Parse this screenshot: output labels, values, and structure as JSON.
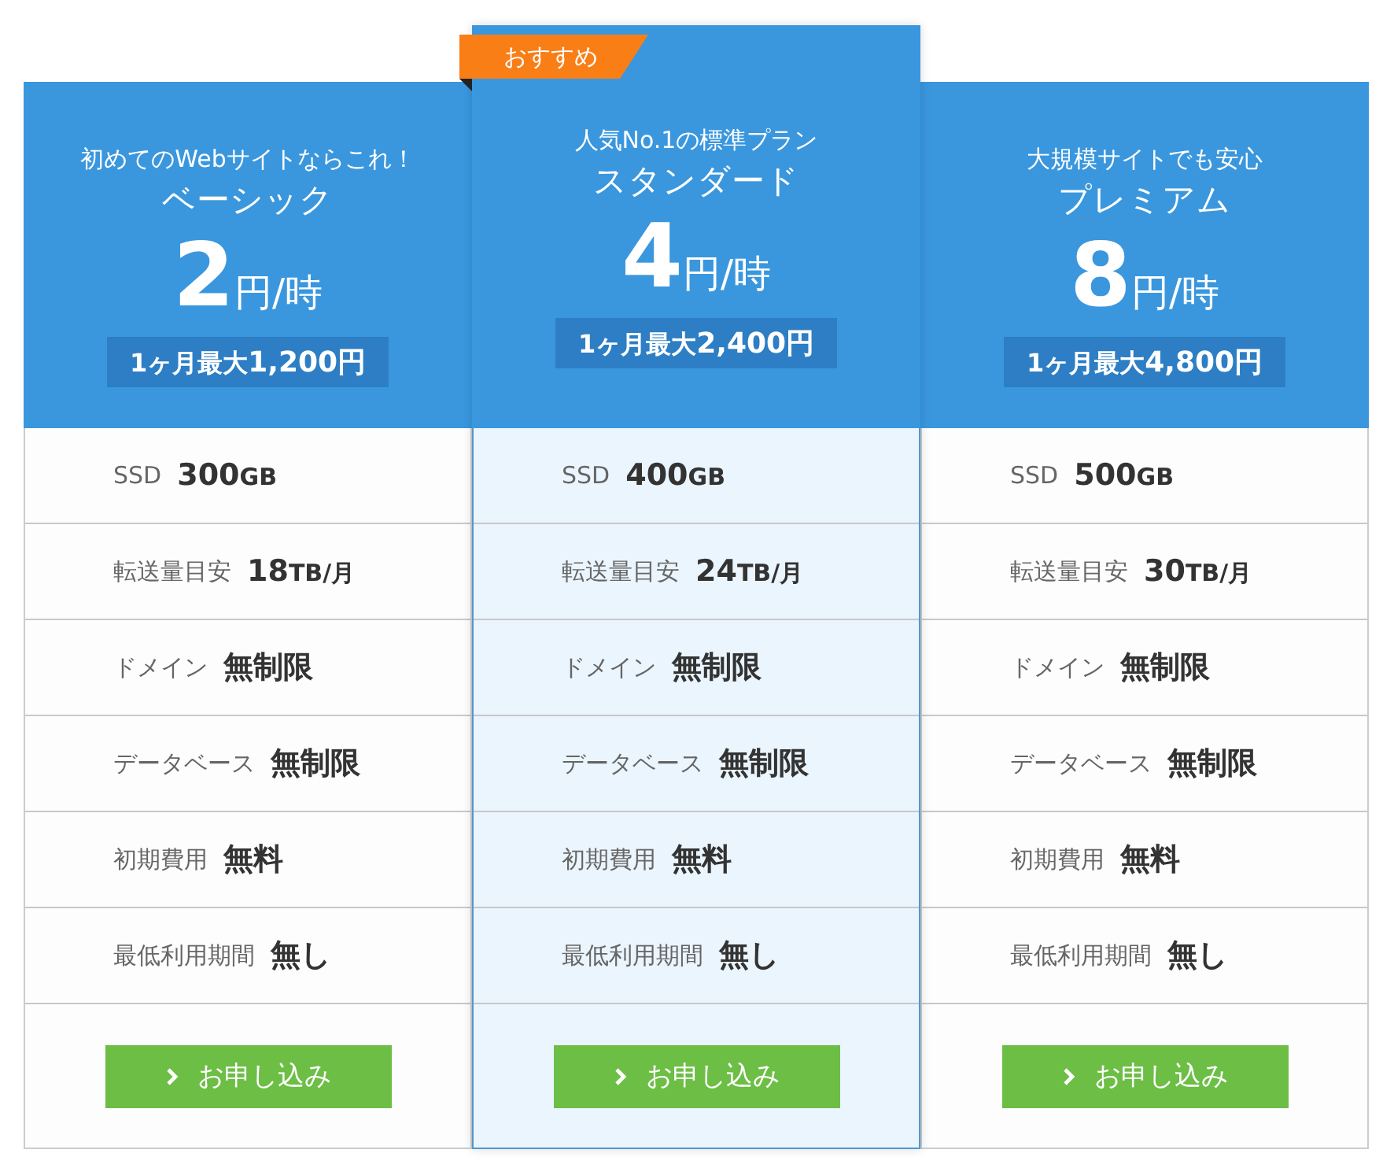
{
  "plans": [
    {
      "featured": false,
      "tagline": "初めてのWebサイトならこれ！",
      "name": "ベーシック",
      "price": "2",
      "price_unit": "円/時",
      "monthly_prefix": "1ヶ月最大",
      "monthly_amount": "1,200円",
      "features": [
        {
          "label": "SSD",
          "value": "300",
          "unit": "GB"
        },
        {
          "label": "転送量目安",
          "value": "18",
          "unit": "TB/月"
        },
        {
          "label": "ドメイン",
          "value": "無制限"
        },
        {
          "label": "データベース",
          "value": "無制限"
        },
        {
          "label": "初期費用",
          "value": "無料"
        },
        {
          "label": "最低利用期間",
          "value": "無し"
        }
      ],
      "button": "お申し込み"
    },
    {
      "featured": true,
      "badge": "おすすめ",
      "tagline": "人気No.1の標準プラン",
      "name": "スタンダード",
      "price": "4",
      "price_unit": "円/時",
      "monthly_prefix": "1ヶ月最大",
      "monthly_amount": "2,400円",
      "features": [
        {
          "label": "SSD",
          "value": "400",
          "unit": "GB"
        },
        {
          "label": "転送量目安",
          "value": "24",
          "unit": "TB/月"
        },
        {
          "label": "ドメイン",
          "value": "無制限"
        },
        {
          "label": "データベース",
          "value": "無制限"
        },
        {
          "label": "初期費用",
          "value": "無料"
        },
        {
          "label": "最低利用期間",
          "value": "無し"
        }
      ],
      "button": "お申し込み"
    },
    {
      "featured": false,
      "tagline": "大規模サイトでも安心",
      "name": "プレミアム",
      "price": "8",
      "price_unit": "円/時",
      "monthly_prefix": "1ヶ月最大",
      "monthly_amount": "4,800円",
      "features": [
        {
          "label": "SSD",
          "value": "500",
          "unit": "GB"
        },
        {
          "label": "転送量目安",
          "value": "30",
          "unit": "TB/月"
        },
        {
          "label": "ドメイン",
          "value": "無制限"
        },
        {
          "label": "データベース",
          "value": "無制限"
        },
        {
          "label": "初期費用",
          "value": "無料"
        },
        {
          "label": "最低利用期間",
          "value": "無し"
        }
      ],
      "button": "お申し込み"
    }
  ]
}
